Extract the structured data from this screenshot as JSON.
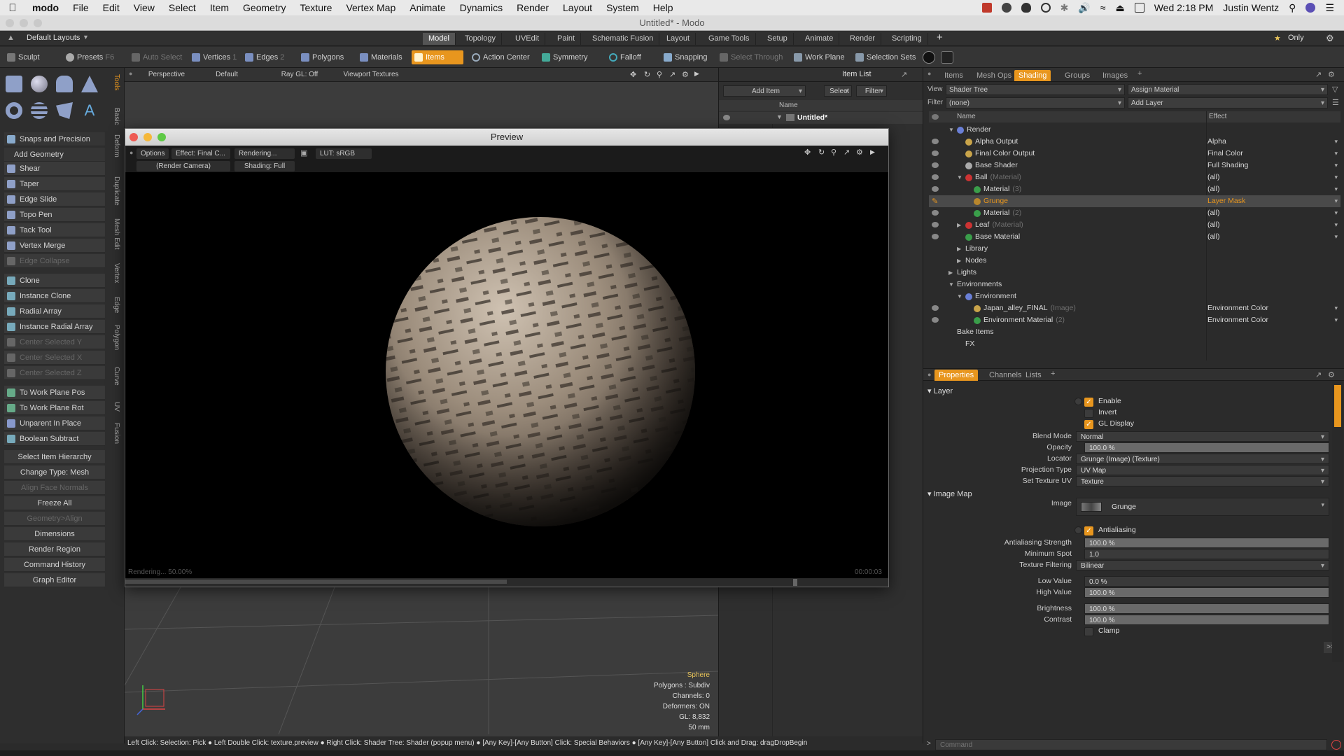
{
  "menubar": {
    "app_name": "modo",
    "menus": [
      "File",
      "Edit",
      "View",
      "Select",
      "Item",
      "Geometry",
      "Texture",
      "Vertex Map",
      "Animate",
      "Dynamics",
      "Render",
      "Layout",
      "System",
      "Help"
    ],
    "clock": "Wed 2:18 PM",
    "user": "Justin Wentz"
  },
  "window": {
    "title": "Untitled* - Modo"
  },
  "layout_bar": {
    "layout_dropdown": "Default Layouts",
    "tabs": [
      "Model",
      "Topology",
      "UVEdit",
      "Paint",
      "Schematic Fusion",
      "Layout",
      "Game Tools",
      "Setup",
      "Animate",
      "Render",
      "Scripting"
    ],
    "active_tab": "Model",
    "only_label": "Only"
  },
  "toolbar": {
    "sculpt": "Sculpt",
    "presets": "Presets",
    "presets_key": "F6",
    "auto_select": "Auto Select",
    "vertices": "Vertices",
    "vertices_key": "1",
    "edges": "Edges",
    "edges_key": "2",
    "polygons": "Polygons",
    "materials": "Materials",
    "items": "Items",
    "action_center": "Action Center",
    "symmetry": "Symmetry",
    "falloff": "Falloff",
    "snapping": "Snapping",
    "select_through": "Select Through",
    "work_plane": "Work Plane",
    "selection_sets": "Selection Sets"
  },
  "left_panel": {
    "snaps": "Snaps and Precision",
    "add_geometry": "Add Geometry",
    "tools": [
      {
        "label": "Shear",
        "enabled": true
      },
      {
        "label": "Taper",
        "enabled": true
      },
      {
        "label": "Edge Slide",
        "enabled": true
      },
      {
        "label": "Topo Pen",
        "enabled": true
      },
      {
        "label": "Tack Tool",
        "enabled": true
      },
      {
        "label": "Vertex Merge",
        "enabled": true
      },
      {
        "label": "Edge Collapse",
        "enabled": false
      },
      {
        "label": "Clone",
        "enabled": true
      },
      {
        "label": "Instance Clone",
        "enabled": true
      },
      {
        "label": "Radial Array",
        "enabled": true
      },
      {
        "label": "Instance Radial Array",
        "enabled": true
      },
      {
        "label": "Center Selected Y",
        "enabled": false
      },
      {
        "label": "Center Selected X",
        "enabled": false
      },
      {
        "label": "Center Selected Z",
        "enabled": false
      },
      {
        "label": "To Work Plane Pos",
        "enabled": true
      },
      {
        "label": "To Work Plane Rot",
        "enabled": true
      },
      {
        "label": "Unparent In Place",
        "enabled": true
      },
      {
        "label": "Boolean Subtract",
        "enabled": true
      },
      {
        "label": "Select Item Hierarchy",
        "enabled": true
      },
      {
        "label": "Change Type: Mesh",
        "enabled": true
      },
      {
        "label": "Align Face Normals",
        "enabled": false
      },
      {
        "label": "Freeze All",
        "enabled": true
      },
      {
        "label": "Geometry>Align",
        "enabled": false
      },
      {
        "label": "Dimensions",
        "enabled": true
      },
      {
        "label": "Render Region",
        "enabled": true
      },
      {
        "label": "Command History",
        "enabled": true
      },
      {
        "label": "Graph Editor",
        "enabled": true
      }
    ],
    "vertical_tabs": [
      "Tools",
      "Basic",
      "Deform",
      "Duplicate",
      "Mesh Edit",
      "Vertex",
      "Edge",
      "Polygon",
      "Curve",
      "UV",
      "Fusion"
    ]
  },
  "viewport": {
    "projection": "Perspective",
    "style": "Default",
    "ray_gl": "Ray GL: Off",
    "viewport_textures": "Viewport Textures",
    "info": [
      "Sphere",
      "Polygons : Subdiv",
      "Channels: 0",
      "Deformers: ON",
      "GL: 8,832",
      "50 mm"
    ]
  },
  "preview": {
    "title": "Preview",
    "options": "Options",
    "effect": "Effect: Final C...",
    "rendering": "Rendering...",
    "lut": "LUT: sRGB",
    "camera": "(Render Camera)",
    "shading": "Shading: Full",
    "progress_text": "Rendering... 50.00%",
    "progress": 0.5,
    "time": "00:00:03"
  },
  "item_list": {
    "add_item": "Add Item",
    "select": "Select",
    "filter": "Filter",
    "title": "Item List",
    "name_col": "Name",
    "root": "Untitled*"
  },
  "shader_panel": {
    "tabs": [
      "Items",
      "Mesh Ops",
      "Shading",
      "Groups",
      "Images"
    ],
    "active_tab": "Shading",
    "view_label": "View",
    "view_value": "Shader Tree",
    "assign_material": "Assign Material",
    "filter_label": "Filter",
    "filter_value": "(none)",
    "add_layer": "Add Layer",
    "col_name": "Name",
    "col_effect": "Effect",
    "rows": [
      {
        "name": "Render",
        "sub": "",
        "effect": "",
        "depth": 0,
        "color": "#6a7fd6",
        "eye": false
      },
      {
        "name": "Alpha Output",
        "sub": "",
        "effect": "Alpha",
        "depth": 1,
        "color": "#c9a44a",
        "eye": true
      },
      {
        "name": "Final Color Output",
        "sub": "",
        "effect": "Final Color",
        "depth": 1,
        "color": "#c9a44a",
        "eye": true
      },
      {
        "name": "Base Shader",
        "sub": "",
        "effect": "Full Shading",
        "depth": 1,
        "color": "#aaaaaa",
        "eye": true
      },
      {
        "name": "Ball",
        "sub": "(Material)",
        "effect": "(all)",
        "depth": 1,
        "color": "#cc3333",
        "eye": true
      },
      {
        "name": "Material",
        "sub": "(3)",
        "effect": "(all)",
        "depth": 2,
        "color": "#3a9e4a",
        "eye": true
      },
      {
        "name": "Grunge",
        "sub": "",
        "effect": "Layer Mask",
        "depth": 2,
        "color": "#b8862d",
        "eye": false,
        "selected": true
      },
      {
        "name": "Material",
        "sub": "(2)",
        "effect": "(all)",
        "depth": 2,
        "color": "#3a9e4a",
        "eye": true
      },
      {
        "name": "Leaf",
        "sub": "(Material)",
        "effect": "(all)",
        "depth": 1,
        "color": "#cc3333",
        "eye": true
      },
      {
        "name": "Base Material",
        "sub": "",
        "effect": "(all)",
        "depth": 1,
        "color": "#3a9e4a",
        "eye": true
      },
      {
        "name": "Library",
        "sub": "",
        "effect": "",
        "depth": 1,
        "color": "",
        "eye": false
      },
      {
        "name": "Nodes",
        "sub": "",
        "effect": "",
        "depth": 1,
        "color": "",
        "eye": false
      },
      {
        "name": "Lights",
        "sub": "",
        "effect": "",
        "depth": 0,
        "color": "",
        "eye": false
      },
      {
        "name": "Environments",
        "sub": "",
        "effect": "",
        "depth": 0,
        "color": "",
        "eye": false
      },
      {
        "name": "Environment",
        "sub": "",
        "effect": "",
        "depth": 1,
        "color": "#6a7fd6",
        "eye": false
      },
      {
        "name": "Japan_alley_FINAL",
        "sub": "(Image)",
        "effect": "Environment Color",
        "depth": 2,
        "color": "#c9a44a",
        "eye": true
      },
      {
        "name": "Environment Material",
        "sub": "(2)",
        "effect": "Environment Color",
        "depth": 2,
        "color": "#3a9e4a",
        "eye": true
      },
      {
        "name": "Bake Items",
        "sub": "",
        "effect": "",
        "depth": 0,
        "color": "",
        "eye": false
      },
      {
        "name": "FX",
        "sub": "",
        "effect": "",
        "depth": 1,
        "color": "",
        "eye": false
      }
    ]
  },
  "properties": {
    "tabs": [
      "Properties",
      "Channels",
      "Lists"
    ],
    "active_tab": "Properties",
    "layer_section": "Layer",
    "enable": "Enable",
    "invert": "Invert",
    "gl_display": "GL Display",
    "blend_mode_label": "Blend Mode",
    "blend_mode": "Normal",
    "opacity_label": "Opacity",
    "opacity": "100.0 %",
    "locator_label": "Locator",
    "locator": "Grunge (Image) (Texture)",
    "projection_label": "Projection Type",
    "projection": "UV Map",
    "set_uv_label": "Set Texture UV",
    "set_uv": "Texture",
    "image_map_section": "Image Map",
    "image_label": "Image",
    "image": "Grunge",
    "antialiasing": "Antialiasing",
    "aa_strength_label": "Antialiasing Strength",
    "aa_strength": "100.0 %",
    "min_spot_label": "Minimum Spot",
    "min_spot": "1.0",
    "filtering_label": "Texture Filtering",
    "filtering": "Bilinear",
    "low_label": "Low Value",
    "low": "0.0 %",
    "high_label": "High Value",
    "high": "100.0 %",
    "brightness_label": "Brightness",
    "brightness": "100.0 %",
    "contrast_label": "Contrast",
    "contrast": "100.0 %",
    "clamp": "Clamp"
  },
  "status_bar": "Left Click: Selection: Pick ● Left Double Click: texture.preview ● Right Click: Shader Tree: Shader (popup menu) ● [Any Key]-[Any Button] Click: Special Behaviors ● [Any Key]-[Any Button] Click and Drag: dragDropBegin",
  "command": {
    "placeholder": "Command"
  },
  "colors": {
    "accent": "#e8961e",
    "background": "#2b2b2b"
  }
}
